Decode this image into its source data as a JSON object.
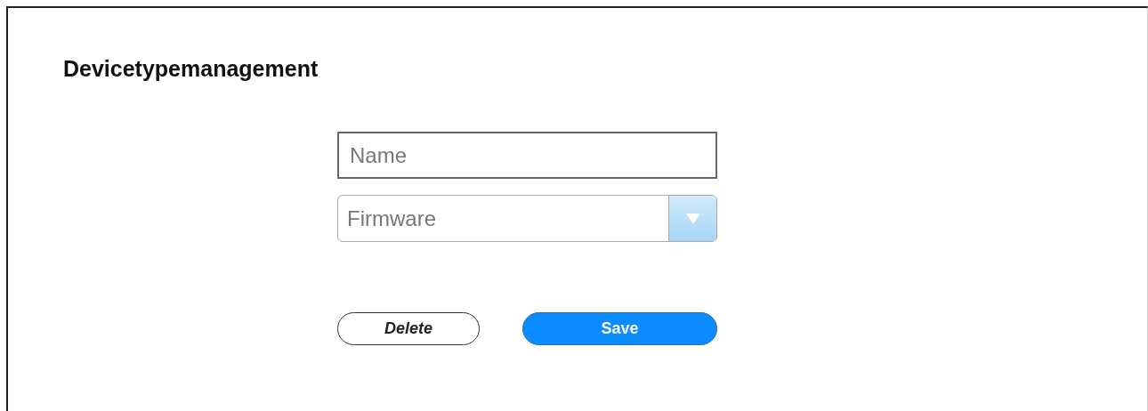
{
  "title": "Devicetypemanagement",
  "name_field": {
    "placeholder": "Name"
  },
  "firmware_select": {
    "placeholder": "Firmware"
  },
  "buttons": [
    {
      "label": "Delete",
      "kind": "secondary"
    },
    {
      "label": "Save",
      "kind": "primary"
    }
  ]
}
